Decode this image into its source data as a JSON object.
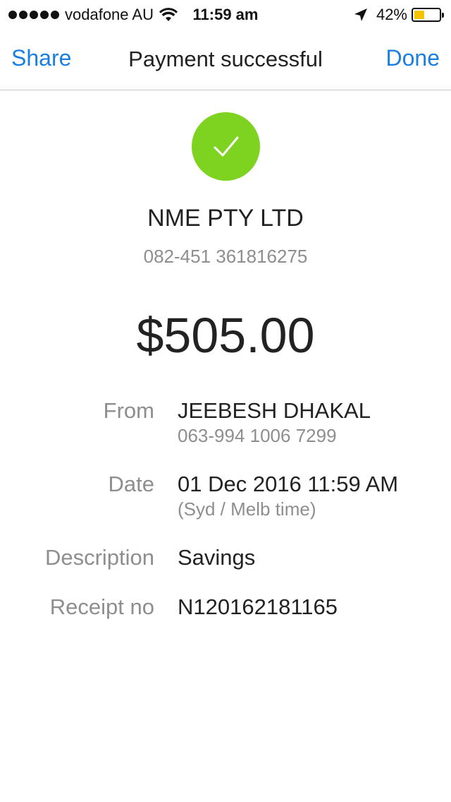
{
  "status_bar": {
    "carrier": "vodafone AU",
    "time": "11:59 am",
    "battery_percent": "42%",
    "battery_level": 0.42,
    "battery_color": "#f5c400",
    "icons": [
      "signal-dots",
      "wifi-icon",
      "location-arrow-icon",
      "battery-icon"
    ]
  },
  "nav": {
    "share_label": "Share",
    "title": "Payment successful",
    "done_label": "Done",
    "accent_color": "#1a7fe0"
  },
  "success": {
    "icon": "checkmark-icon",
    "color": "#7ed321"
  },
  "payee": {
    "name": "NME PTY LTD",
    "account": "082-451 361816275"
  },
  "amount": "$505.00",
  "details": {
    "from": {
      "label": "From",
      "value": "JEEBESH DHAKAL",
      "sub": "063-994 1006 7299"
    },
    "date": {
      "label": "Date",
      "value": "01 Dec 2016 11:59 AM",
      "sub": "(Syd / Melb time)"
    },
    "description": {
      "label": "Description",
      "value": "Savings"
    },
    "receipt": {
      "label": "Receipt no",
      "value": "N120162181165"
    }
  }
}
